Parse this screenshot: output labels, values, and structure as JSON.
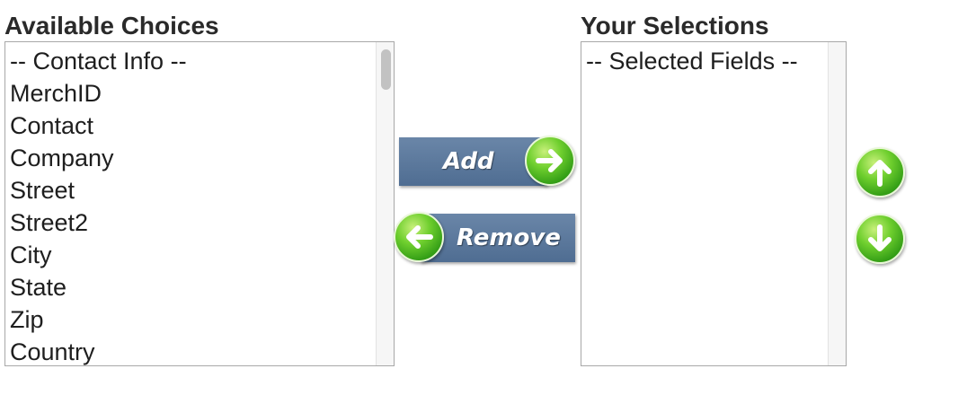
{
  "available": {
    "heading": "Available Choices",
    "options": [
      "-- Contact Info --",
      "MerchID",
      "Contact",
      "Company",
      "Street",
      "Street2",
      "City",
      "State",
      "Zip",
      "Country"
    ]
  },
  "selections": {
    "heading": "Your Selections",
    "options": [
      "-- Selected Fields --"
    ]
  },
  "actions": {
    "add_label": "Add",
    "remove_label": "Remove"
  },
  "icons": {
    "add": "arrow-right-icon",
    "remove": "arrow-left-icon",
    "move_up": "arrow-up-icon",
    "move_down": "arrow-down-icon"
  },
  "colors": {
    "button_bar": "#5a7799",
    "icon_green": "#3fae1c"
  }
}
